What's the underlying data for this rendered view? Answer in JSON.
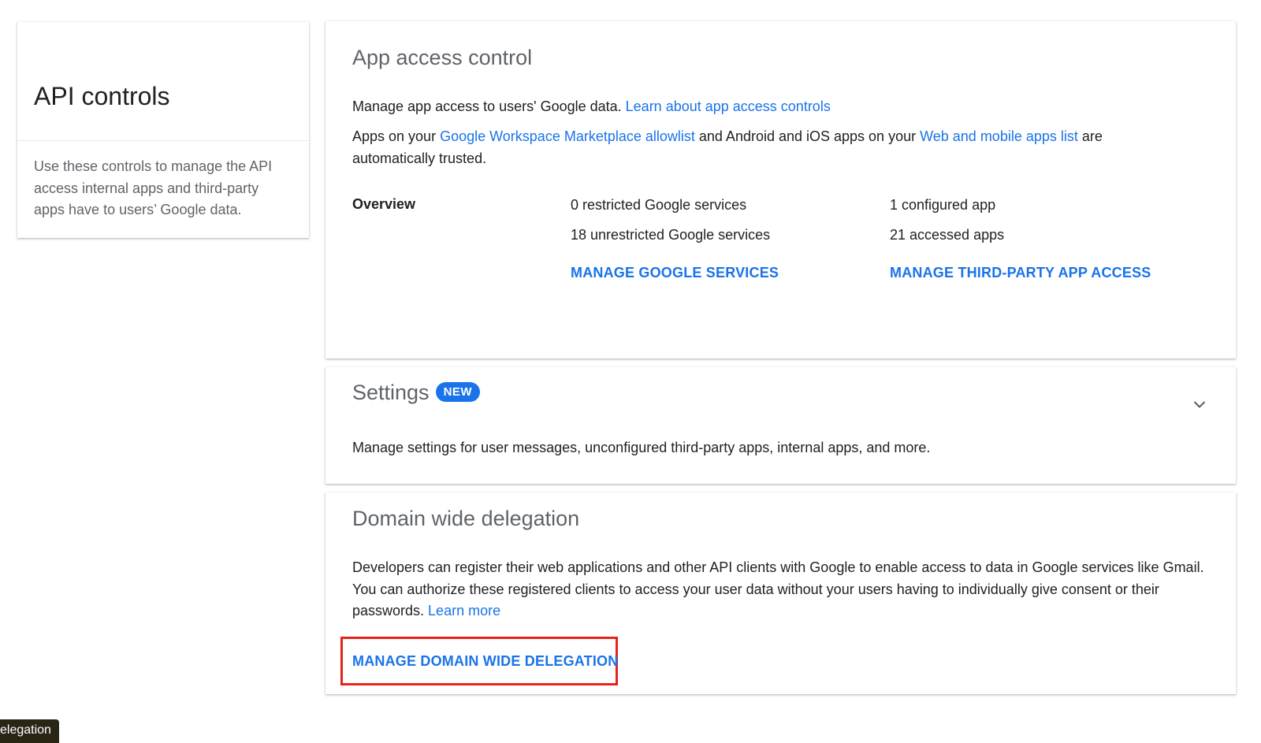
{
  "left": {
    "title": "API controls",
    "description": "Use these controls to manage the API access internal apps and third-party apps have to users’ Google data."
  },
  "app_access": {
    "title": "App access control",
    "intro_text": "Manage app access to users' Google data. ",
    "intro_link": "Learn about app access controls",
    "trusted_prefix": "Apps on your ",
    "trusted_link1": "Google Workspace Marketplace allowlist",
    "trusted_middle": " and Android and iOS apps on your ",
    "trusted_link2": "Web and mobile apps list",
    "trusted_suffix": " are automatically trusted.",
    "overview_label": "Overview",
    "restricted": "0 restricted Google services",
    "unrestricted": "18 unrestricted Google services",
    "configured": "1 configured app",
    "accessed": "21 accessed apps",
    "manage_services": "MANAGE GOOGLE SERVICES",
    "manage_third_party": "MANAGE THIRD-PARTY APP ACCESS"
  },
  "settings": {
    "title": "Settings",
    "badge": "NEW",
    "description": "Manage settings for user messages, unconfigured third-party apps, internal apps, and more.",
    "expand_icon": "chevron-down-icon"
  },
  "domain": {
    "title": "Domain wide delegation",
    "description": "Developers can register their web applications and other API clients with Google to enable access to data in Google services like Gmail. You can authorize these registered clients to access your user data without your users having to individually give consent or their passwords. ",
    "learn_more": "Learn more",
    "manage_button": "MANAGE DOMAIN WIDE DELEGATION"
  },
  "tooltip": {
    "text": "elegation"
  },
  "colors": {
    "link": "#1a73e8",
    "highlight": "#e5231b",
    "badge": "#1a73e8"
  }
}
